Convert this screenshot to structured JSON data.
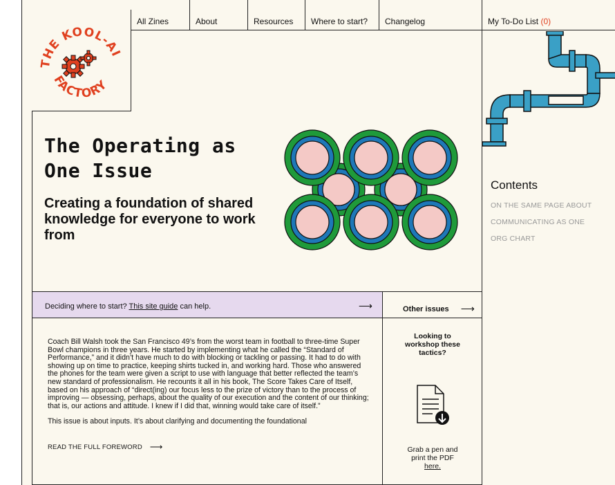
{
  "nav": {
    "items": [
      {
        "label": "All Zines"
      },
      {
        "label": "About"
      },
      {
        "label": "Resources"
      },
      {
        "label": "Where to start?"
      },
      {
        "label": "Changelog"
      }
    ],
    "todo_label": "My To-Do List",
    "todo_count": "(0)"
  },
  "logo": {
    "text_top": "THE KOOL-AID",
    "text_bottom": "FACTORY"
  },
  "hero": {
    "title": "The Operating as One Issue",
    "subtitle": "Creating a foundation of shared knowledge for everyone to work from"
  },
  "contents": {
    "title": "Contents",
    "items": [
      {
        "label": "ON THE SAME PAGE ABOUT"
      },
      {
        "label": "COMMUNICATING AS ONE"
      },
      {
        "label": "ORG CHART"
      }
    ]
  },
  "banner": {
    "text": "Deciding where to start?",
    "link": "This site guide",
    "suffix": "can help.",
    "arrow": "⟶"
  },
  "other_issues": {
    "label": "Other issues",
    "arrow": "⟶"
  },
  "foreword": {
    "p1": "Coach Bill Walsh took the San Francisco 49’s from the worst team in football to three-time Super Bowl champions in three years. He started by implementing what he called the “Standard of Performance,” and it didn’t have much to do with blocking or tackling or passing. It had to do with showing up on time to practice, keeping shirts tucked in, and working hard. Those who answered the phones for the team were given a script to use with language that better reflected the team’s new standard of professionalism. He recounts it all in his book, The Score Takes Care of Itself, based on his approach of “direct(ing) our focus less to the prize of victory than to the process of improving — obsessing, perhaps, about the quality of our execution and the content of our thinking; that is, our actions and attitude. I knew if I did that, winning would take care of itself.”",
    "p2": "This issue is about inputs. It’s about clarifying and documenting the foundational",
    "read_more": "READ THE FULL FOREWORD",
    "read_more_arrow": "⟶"
  },
  "workshop": {
    "question": "Looking to workshop these tactics?",
    "grab_text": "Grab a pen and print the PDF",
    "grab_link": "here."
  },
  "colors": {
    "accent_orange": "#e0401f",
    "banner_lavender": "#e6d9ee",
    "page_cream": "#fbf8ee",
    "ring_green": "#1f9a3a",
    "ring_blue": "#1e78b8",
    "ring_pink": "#f4c9c6",
    "pipe_teal": "#3aa0c6"
  }
}
